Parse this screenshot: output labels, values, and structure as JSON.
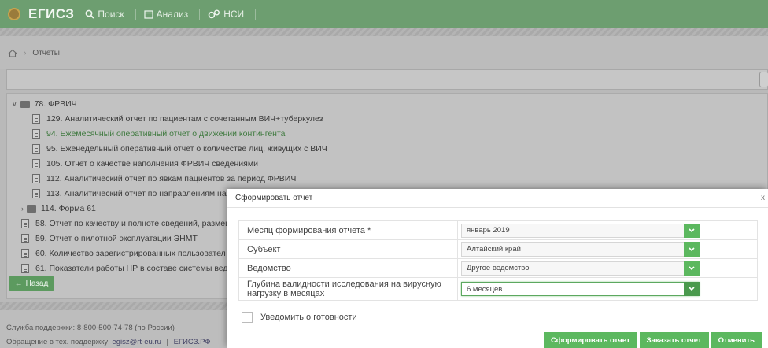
{
  "header": {
    "brand": "ЕГИСЗ",
    "nav": [
      {
        "label": "Поиск",
        "icon": "search-icon"
      },
      {
        "label": "Анализ",
        "icon": "calendar-icon"
      },
      {
        "label": "НСИ",
        "icon": "gears-icon"
      }
    ]
  },
  "breadcrumb": {
    "current": "Отчеты"
  },
  "tree": {
    "group_label": "78. ФРВИЧ",
    "children": [
      "129. Аналитический отчет по пациентам с сочетанным ВИЧ+туберкулез",
      "94. Ежемесячный оперативный отчет о движении контингента",
      "95. Еженедельный оперативный отчет о количестве лиц, живущих с ВИЧ",
      "105. Отчет о качестве наполнения ФРВИЧ сведениями",
      "112. Аналитический отчет по явкам пациентов за период ФРВИЧ",
      "113. Аналитический отчет по направлениям на лабораторные исследования за период ФРВИЧ"
    ],
    "subfolder": "114. Форма 61",
    "others": [
      "58. Отчет по качеству и полноте сведений, размещ",
      "59. Отчет о пилотной эксплуатации ЭНМТ",
      "60. Количество зарегистрированных пользовател",
      "61. Показатели работы НР в составе системы вед"
    ]
  },
  "back_button": "Назад",
  "footer": {
    "support_line": "Служба поддержки: 8-800-500-74-78 (по России)",
    "contact_prefix": "Обращение в тех. поддержку:",
    "email": "egisz@rt-eu.ru",
    "divider": "|",
    "site": "ЕГИСЗ.РФ"
  },
  "modal": {
    "title": "Сформировать отчет",
    "close": "x",
    "fields": [
      {
        "label": "Месяц формирования отчета *",
        "value": "январь 2019"
      },
      {
        "label": "Субъект",
        "value": "Алтайский край"
      },
      {
        "label": "Ведомство",
        "value": "Другое ведомство"
      },
      {
        "label": "Глубина валидности исследования на вирусную нагрузку в месяцах",
        "value": "6 месяцев"
      }
    ],
    "notify_label": "Уведомить о готовности",
    "buttons": {
      "generate": "Сформировать отчет",
      "order": "Заказать отчет",
      "cancel": "Отменить"
    }
  },
  "colors": {
    "accent": "#5cb85f",
    "header": "#6d9e70",
    "active_link": "#3f7a3f"
  }
}
